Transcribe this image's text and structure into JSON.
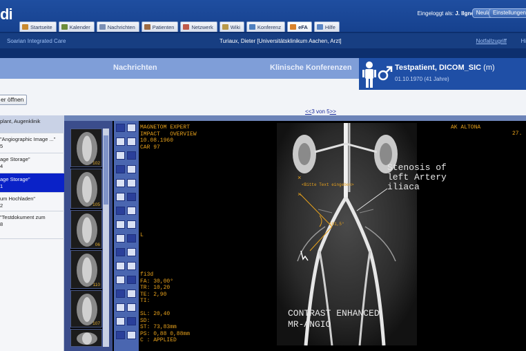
{
  "header": {
    "logo_text": "di",
    "logged_in_label": "Eingeloggt als:",
    "logged_in_user": "J. Ilgner",
    "buttons": {
      "reload": "Neuladen",
      "settings": "Einstellungen"
    },
    "tabs": [
      {
        "label": "Startseite",
        "icon": "home-icon",
        "color": "#c98a2f"
      },
      {
        "label": "Kalender",
        "icon": "calendar-icon",
        "color": "#6d8d3b"
      },
      {
        "label": "Nachrichten",
        "icon": "envelope-icon",
        "color": "#7a8fb5"
      },
      {
        "label": "Patienten",
        "icon": "patients-icon",
        "color": "#9c6b43"
      },
      {
        "label": "Netzwerk",
        "icon": "network-icon",
        "color": "#c05a4a"
      },
      {
        "label": "Wiki",
        "icon": "wiki-icon",
        "color": "#b99a4a"
      },
      {
        "label": "Konferenz",
        "icon": "conference-icon",
        "color": "#4d7fbf"
      },
      {
        "label": "eFA",
        "icon": "efa-icon",
        "color": "#d9822b",
        "active": true
      },
      {
        "label": "Hilfe",
        "icon": "help-icon",
        "color": "#5b86c4"
      }
    ]
  },
  "subbar": {
    "left": "Soarian Integrated Care",
    "center": "Turiaux, Dieter [Universitätsklinikum Aachen, Arzt]",
    "right": "Notfallzugriff",
    "right2": "Hi"
  },
  "sections": {
    "messages": "Nachrichten",
    "conferences": "Klinische Konferenzen"
  },
  "patient": {
    "name": "Testpatient, DICOM_SIC",
    "sex": "(m)",
    "dob": "01.10.1970 (41 Jahre)"
  },
  "open_button": "er öffnen",
  "pager": {
    "prev": "<<",
    "text": "3 von 5",
    "next": ">>"
  },
  "documents": [
    {
      "line1": "plant, Augenklinik",
      "line2": ""
    },
    {
      "line1": "\"Angiographic Image ...\"",
      "line2": "5"
    },
    {
      "line1": "age Storage\"",
      "line2": "4"
    },
    {
      "line1": "age Storage\"",
      "line2": "1",
      "selected": true
    },
    {
      "line1": "um Hochladen\"",
      "line2": "2"
    },
    {
      "line1": "\"Testdokument zum",
      "line2": "8"
    }
  ],
  "thumbnails": [
    "102",
    "105",
    "06",
    "110",
    "107",
    ""
  ],
  "overlay": {
    "top_left": "MAGNETOM EXPERT\nIMPACT   OVERVIEW\n10.08.1960\nCAR 97",
    "top_right": "AK ALTONA",
    "top_right2": "27.",
    "left_mark": "L",
    "params": "fi3d\nFA: 30,00°\nTR: 10,20\nTE: 2,90\nTI:\n\nSL: 20,40\nSD:\nST: 73,83mm\nPS: 0,88 0,88mm\nC : APPLIED"
  },
  "annotations": {
    "stenosis": "Stenosis of\nleft Artery\niliaca",
    "text_hint": "<Bitte Text eingeben>",
    "angle": "101,5°",
    "contrast": "CONTRAST ENHANCED\nMR-ANGIO"
  }
}
